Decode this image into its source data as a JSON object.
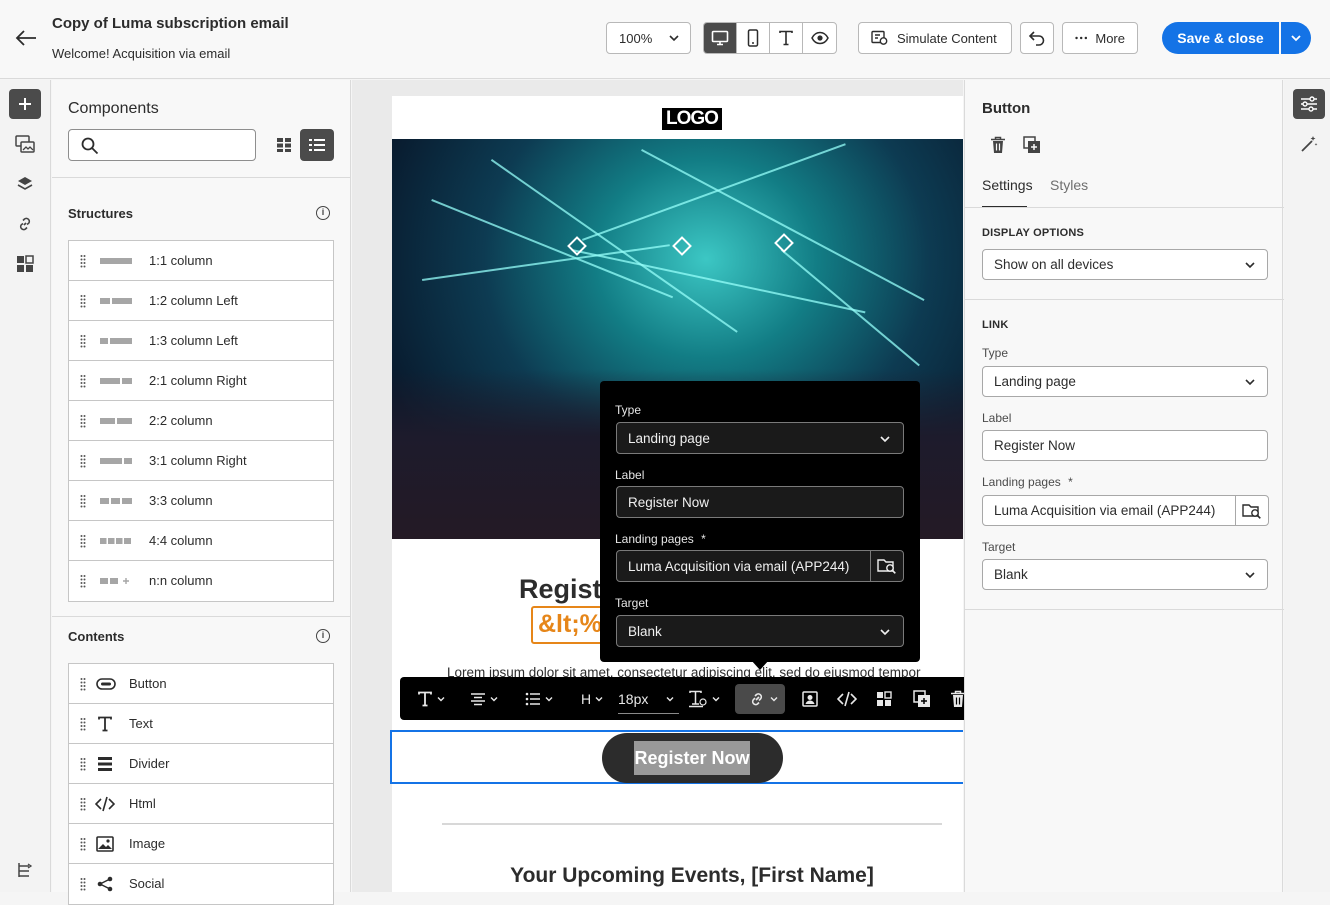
{
  "header": {
    "title": "Copy of Luma subscription email",
    "subtitle": "Welcome! Acquisition via email",
    "zoom": "100%",
    "simulate_label": "Simulate Content",
    "more_label": "More",
    "save_label": "Save & close"
  },
  "components": {
    "title": "Components",
    "search_placeholder": "",
    "structures_title": "Structures",
    "structures": [
      {
        "label": "1:1 column"
      },
      {
        "label": "1:2 column Left"
      },
      {
        "label": "1:3 column Left"
      },
      {
        "label": "2:1 column Right"
      },
      {
        "label": "2:2 column"
      },
      {
        "label": "3:1 column Right"
      },
      {
        "label": "3:3 column"
      },
      {
        "label": "4:4 column"
      },
      {
        "label": "n:n column"
      }
    ],
    "contents_title": "Contents",
    "contents": [
      {
        "label": "Button",
        "icon": "button-icon"
      },
      {
        "label": "Text",
        "icon": "text-icon"
      },
      {
        "label": "Divider",
        "icon": "divider-icon"
      },
      {
        "label": "Html",
        "icon": "code-icon"
      },
      {
        "label": "Image",
        "icon": "image-icon"
      },
      {
        "label": "Social",
        "icon": "share-icon"
      }
    ]
  },
  "email": {
    "logo": "LOGO",
    "heading": "Regist",
    "token": "&lt;%",
    "lorem": "Lorem ipsum dolor sit amet, consectetur adipiscing elit, sed do eiusmod tempor",
    "button_label": "Register Now",
    "upcoming": "Your Upcoming Events, [First Name]"
  },
  "toolbar": {
    "font_size": "18px",
    "heading_label": "H"
  },
  "popover": {
    "type_label": "Type",
    "type_value": "Landing page",
    "label_label": "Label",
    "label_value": "Register Now",
    "landing_label": "Landing pages",
    "landing_value": "Luma Acquisition via email (APP244)",
    "required_mark": "*",
    "target_label": "Target",
    "target_value": "Blank"
  },
  "properties": {
    "title": "Button",
    "tab_settings": "Settings",
    "tab_styles": "Styles",
    "display_section": "DISPLAY OPTIONS",
    "display_value": "Show on all devices",
    "link_section": "LINK",
    "type_label": "Type",
    "type_value": "Landing page",
    "label_label": "Label",
    "label_value": "Register Now",
    "landing_label": "Landing pages",
    "landing_value": "Luma Acquisition via email (APP244)",
    "required_mark": "*",
    "target_label": "Target",
    "target_value": "Blank"
  },
  "colors": {
    "accent": "#1473e6",
    "token": "#e68619",
    "dark_button": "#2c2c2c"
  }
}
